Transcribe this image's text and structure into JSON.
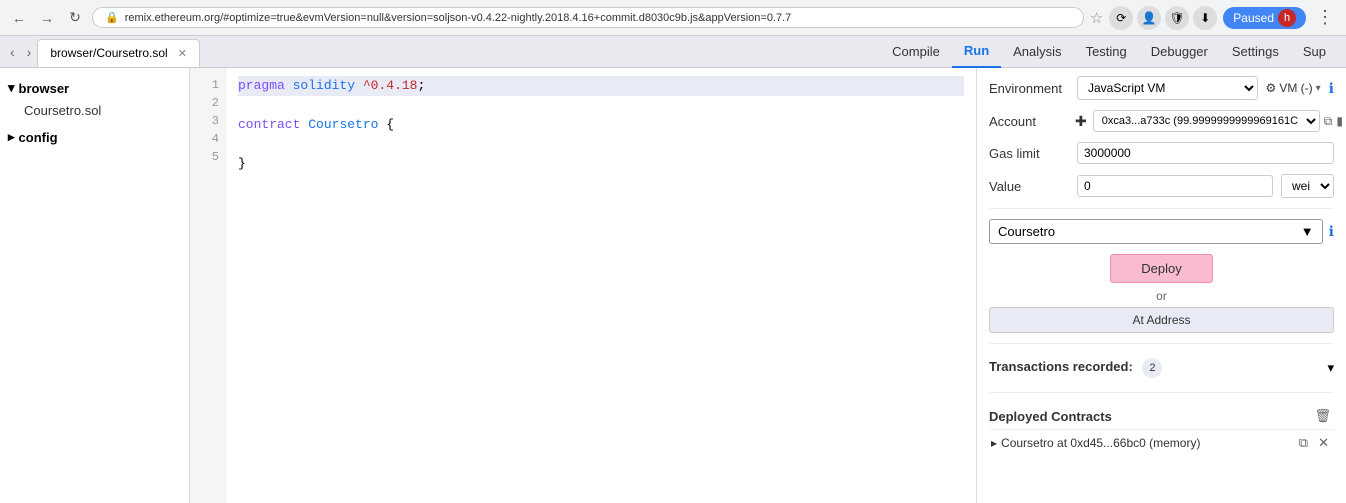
{
  "browser": {
    "address": "remix.ethereum.org/#optimize=true&evmVersion=null&version=soljson-v0.4.22-nightly.2018.4.16+commit.d8030c9b.js&appVersion=0.7.7",
    "lock_icon": "🔒",
    "paused_label": "Paused",
    "paused_avatar": "h"
  },
  "tabs": [
    {
      "label": "browser/Coursetro.sol",
      "active": true
    }
  ],
  "top_nav": {
    "compile": "Compile",
    "run": "Run",
    "analysis": "Analysis",
    "testing": "Testing",
    "debugger": "Debugger",
    "settings": "Settings",
    "support": "Sup"
  },
  "sidebar": {
    "browser_label": "browser",
    "browser_file": "Coursetro.sol",
    "config_label": "config"
  },
  "editor": {
    "lines": [
      {
        "num": 1,
        "code": "pragma solidity ^0.4.18;",
        "highlight": true
      },
      {
        "num": 2,
        "code": "",
        "highlight": false
      },
      {
        "num": 3,
        "code": "contract Coursetro {",
        "highlight": false
      },
      {
        "num": 4,
        "code": "",
        "highlight": false
      },
      {
        "num": 5,
        "code": "}",
        "highlight": false
      }
    ]
  },
  "right_panel": {
    "environment_label": "Environment",
    "environment_value": "JavaScript VM",
    "vm_badge": "VM (-)",
    "info_icon": "ℹ",
    "account_label": "Account",
    "account_value": "0xca3...a733c (99.9999999999969161C",
    "gas_limit_label": "Gas limit",
    "gas_limit_value": "3000000",
    "value_label": "Value",
    "value_amount": "0",
    "value_unit": "wei",
    "contract_name": "Coursetro",
    "deploy_label": "Deploy",
    "or_text": "or",
    "at_address_label": "At Address",
    "transactions_label": "Transactions recorded:",
    "transactions_count": "2",
    "deployed_contracts_label": "Deployed Contracts",
    "deployed_item_label": "Coursetro at 0xd45...66bc0 (memory)",
    "copy_icon": "📋",
    "delete_icon": "🗑",
    "close_icon": "✕",
    "chevron_down": "▾",
    "chevron_expand": "▾"
  }
}
